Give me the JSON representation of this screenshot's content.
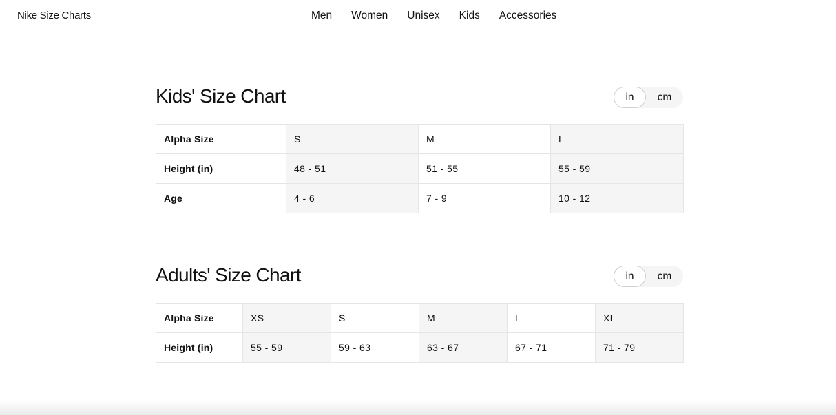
{
  "header": {
    "brand": "Nike Size Charts",
    "nav": [
      "Men",
      "Women",
      "Unisex",
      "Kids",
      "Accessories"
    ]
  },
  "kids": {
    "title": "Kids' Size Chart",
    "units": {
      "active": "in",
      "other": "cm"
    },
    "rows": [
      {
        "label": "Alpha Size",
        "cells": [
          "S",
          "M",
          "L"
        ]
      },
      {
        "label": "Height (in)",
        "cells": [
          "48 - 51",
          "51 - 55",
          "55 - 59"
        ]
      },
      {
        "label": "Age",
        "cells": [
          "4 - 6",
          "7 - 9",
          "10 - 12"
        ]
      }
    ]
  },
  "adults": {
    "title": "Adults' Size Chart",
    "units": {
      "active": "in",
      "other": "cm"
    },
    "rows": [
      {
        "label": "Alpha Size",
        "cells": [
          "XS",
          "S",
          "M",
          "L",
          "XL"
        ]
      },
      {
        "label": "Height (in)",
        "cells": [
          "55 - 59",
          "59 - 63",
          "63 - 67",
          "67 - 71",
          "71 - 79"
        ]
      }
    ]
  },
  "colors": {
    "text": "#111111",
    "cell_shade": "#f5f5f5",
    "border": "#e5e5e5",
    "toggle_bg": "#f5f5f5"
  }
}
